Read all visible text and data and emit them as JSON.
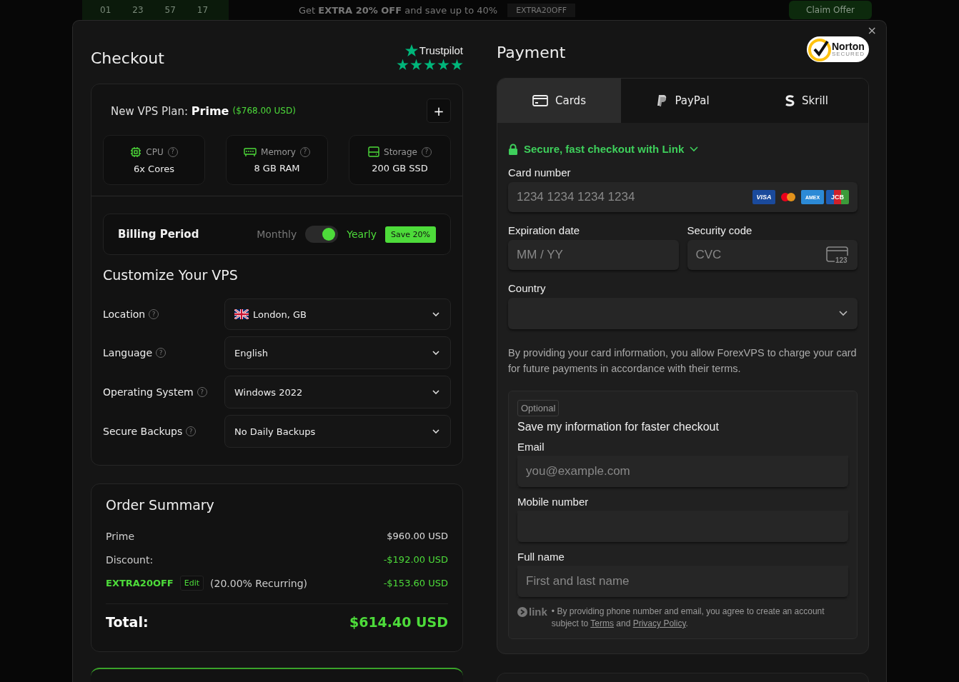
{
  "banner": {
    "countdown": [
      "01",
      "23",
      "57",
      "17"
    ],
    "text": "Get **EXTRA 20% OFF** and save up to 40%",
    "code": "EXTRA20OFF",
    "button": "Claim Offer"
  },
  "close": "×",
  "checkout": {
    "title": "Checkout",
    "trustpilot": {
      "label": "Trustpilot",
      "stars": 5
    },
    "plan": {
      "label": "New VPS Plan:",
      "name": "Prime",
      "price": "($768.00 USD)",
      "add": "+"
    },
    "specs": [
      {
        "kind": "cpu",
        "label": "CPU",
        "help": "?",
        "value": "6x Cores"
      },
      {
        "kind": "memory",
        "label": "Memory",
        "help": "?",
        "value": "8 GB RAM"
      },
      {
        "kind": "storage",
        "label": "Storage",
        "help": "?",
        "value": "200 GB SSD"
      }
    ],
    "billing": {
      "label": "Billing Period",
      "options": [
        {
          "label": "Monthly",
          "selected": false
        },
        {
          "label": "Yearly",
          "selected": true
        }
      ],
      "badge": "Save 20%"
    },
    "customize": {
      "title": "Customize Your VPS",
      "fields": [
        {
          "label": "Location",
          "help": "?",
          "value": "London, GB",
          "kind": "flag"
        },
        {
          "label": "Language",
          "help": "?",
          "value": "English",
          "kind": "plain"
        },
        {
          "label": "Operating System",
          "help": "?",
          "value": "Windows 2022",
          "kind": "plain"
        },
        {
          "label": "Secure Backups",
          "help": "?",
          "value": "No Daily Backups",
          "kind": "plain"
        }
      ]
    }
  },
  "order_summary": {
    "title": "Order Summary",
    "lines": [
      {
        "kind": "plain",
        "label": "Prime",
        "amount": "$960.00 USD"
      },
      {
        "kind": "discount",
        "label": "Discount:",
        "amount": "-$192.00 USD"
      },
      {
        "kind": "coupon",
        "label": "EXTRA20OFF",
        "edit": "Edit",
        "note": "(20.00% Recurring)",
        "amount": "-$153.60 USD"
      }
    ],
    "total_label": "Total:",
    "total": "$614.40 USD"
  },
  "payment": {
    "title": "Payment",
    "norton": {
      "name": "Norton",
      "sub": "SECURED"
    },
    "tabs": [
      {
        "kind": "card",
        "label": "Cards",
        "selected": true
      },
      {
        "kind": "paypal",
        "label": "PayPal",
        "selected": false
      },
      {
        "kind": "skrill",
        "label": "Skrill",
        "selected": false
      }
    ],
    "link_notice": "Secure, fast checkout with Link",
    "card_number": {
      "label": "Card number",
      "placeholder": "1234 1234 1234 1234",
      "brands": [
        {
          "kind": "visa",
          "label": "VISA"
        },
        {
          "kind": "mastercard"
        },
        {
          "kind": "amex",
          "label": "AMEX"
        },
        {
          "kind": "jcb",
          "label": "JCB"
        }
      ]
    },
    "expiration": {
      "label": "Expiration date",
      "placeholder": "MM / YY"
    },
    "security": {
      "label": "Security code",
      "placeholder": "CVC",
      "icon_text": "123"
    },
    "country": {
      "label": "Country"
    },
    "notice": "By providing your card information, you allow ForexVPS to charge your card for future payments in accordance with their terms.",
    "save": {
      "badge": "Optional",
      "title": "Save my information for faster checkout",
      "fields": [
        {
          "label": "Email",
          "placeholder": "you@example.com"
        },
        {
          "label": "Mobile number"
        },
        {
          "label": "Full name",
          "placeholder": "First and last name"
        }
      ],
      "brand": "link",
      "legal": "• By providing phone number and email, you agree to create an account subject to",
      "terms": "Terms",
      "and": "and",
      "privacy": "Privacy Policy",
      "end": "."
    }
  }
}
